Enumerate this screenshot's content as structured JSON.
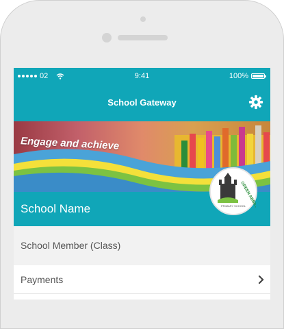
{
  "status_bar": {
    "carrier": "02",
    "time": "9:41",
    "battery": "100%"
  },
  "nav": {
    "title": "School Gateway",
    "settings_icon": "gear-icon"
  },
  "banner": {
    "slogan": "Engage and achieve"
  },
  "logo": {
    "top_text": "GREEN ABBEY",
    "bottom_text": "PRIMARY SCHOOL"
  },
  "school": {
    "name": "School Name",
    "member": "School Member (Class)"
  },
  "menu": {
    "items": [
      {
        "label": "Payments",
        "icon": "chevron-right-icon"
      }
    ]
  },
  "colors": {
    "accent": "#10a6b8",
    "row_bg": "#f2f2f2",
    "text_gray": "#555555"
  }
}
